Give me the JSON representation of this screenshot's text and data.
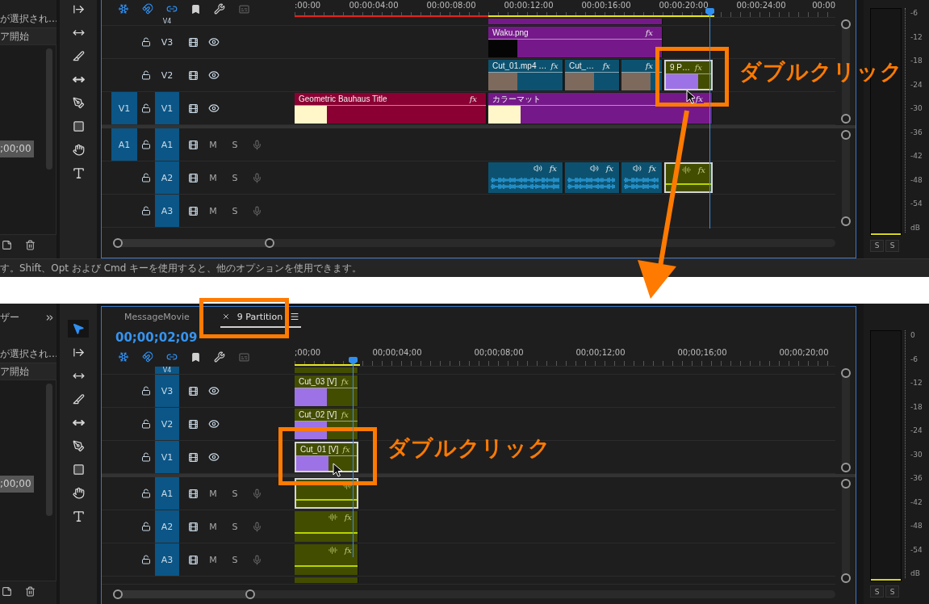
{
  "views": [
    {
      "left_panel": {
        "message": "が選択され…",
        "column": "ア開始",
        "rows": [
          {
            "text": ";00;00",
            "selected": true
          }
        ]
      },
      "tools": [
        {
          "kind": "track_select",
          "selected": false
        },
        {
          "kind": "ripple",
          "selected": false
        },
        {
          "kind": "razor",
          "selected": false
        },
        {
          "kind": "slip",
          "selected": false
        },
        {
          "kind": "pen",
          "selected": false
        },
        {
          "kind": "rectangle",
          "selected": false
        },
        {
          "kind": "hand",
          "selected": false
        },
        {
          "kind": "type",
          "selected": false
        }
      ],
      "toolbar": [
        {
          "kind": "nest",
          "on": true
        },
        {
          "kind": "snap",
          "on": true
        },
        {
          "kind": "linked",
          "on": true
        },
        {
          "kind": "marker",
          "on": false
        },
        {
          "kind": "settings",
          "on": false
        },
        {
          "kind": "captions",
          "on": false
        }
      ],
      "ruler": [
        ":00:00",
        "00:00:04:00",
        "00:00:08:00",
        "00:00:12:00",
        "00:00:16:00",
        "00:00:20:00",
        "00:00:24:00",
        "00:00"
      ],
      "tracks": [
        {
          "kind": "video",
          "label": "V4",
          "targeted": false,
          "clips": [
            {
              "kind": "strip",
              "color": "#75198a",
              "selected": false
            }
          ]
        },
        {
          "kind": "video",
          "label": "V3",
          "targeted": false,
          "clips": [
            {
              "kind": "image",
              "title": "Waku.png",
              "fx": "fx",
              "color": "#75198a",
              "selected": false
            }
          ]
        },
        {
          "kind": "video",
          "label": "V2",
          "targeted": false,
          "clips": [
            {
              "kind": "video",
              "title": "Cut_01.mp4 …",
              "fx": "fx",
              "color": "#0c5270",
              "selected": false
            },
            {
              "kind": "video",
              "title": "Cut_…",
              "fx": "fx",
              "color": "#0c5270",
              "selected": false
            },
            {
              "kind": "video",
              "fx": "fx",
              "color": "#0c5270",
              "selected": false
            },
            {
              "kind": "nest",
              "title": "9 P…",
              "fx": "fx",
              "color": "#434d00",
              "selected": true
            }
          ]
        },
        {
          "kind": "video",
          "label": "V1",
          "source": "V1",
          "targeted": true,
          "clips": [
            {
              "kind": "graphic",
              "title": "Geometric Bauhaus Title",
              "fx": "fx",
              "color": "#8a0032",
              "selected": false
            },
            {
              "kind": "graphic",
              "title": "カラーマット",
              "fx": "fx",
              "color": "#75198a",
              "selected": false
            }
          ]
        },
        {
          "kind": "audio",
          "label": "A1",
          "source": "A1",
          "targeted": true,
          "mute": "M",
          "solo": "S"
        },
        {
          "kind": "audio",
          "label": "A2",
          "targeted": true,
          "mute": "M",
          "solo": "S",
          "clips": [
            {
              "kind": "audio",
              "fx": "fx",
              "color": "#0c5270",
              "selected": false
            },
            {
              "kind": "audio",
              "fx": "fx",
              "color": "#0c5270",
              "selected": false
            },
            {
              "kind": "audio",
              "fx": "fx",
              "color": "#0c5270",
              "selected": false
            },
            {
              "kind": "nest_audio",
              "fx": "fx",
              "color": "#434d00",
              "selected": true
            }
          ]
        },
        {
          "kind": "audio",
          "label": "A3",
          "targeted": true,
          "mute": "M",
          "solo": "S"
        }
      ],
      "meter": {
        "scale": [
          "-6",
          "-12",
          "-18",
          "-24",
          "-30",
          "-36",
          "-42",
          "-48",
          "-54",
          "dB"
        ],
        "solo": [
          "S",
          "S"
        ]
      }
    },
    {
      "left_panel": {
        "tab": "ザー",
        "message": "が選択され…",
        "column": "ア開始",
        "rows": [
          {
            "text": ";00;00",
            "selected": true
          }
        ]
      },
      "tabs": [
        {
          "label": "MessageMovie",
          "selected": false
        },
        {
          "label": "9 Partition",
          "selected": true
        }
      ],
      "timecode": "00;00;02;09",
      "tools": [
        {
          "kind": "selection",
          "selected": true
        },
        {
          "kind": "track_select",
          "selected": false
        },
        {
          "kind": "ripple",
          "selected": false
        },
        {
          "kind": "razor",
          "selected": false
        },
        {
          "kind": "slip",
          "selected": false
        },
        {
          "kind": "pen",
          "selected": false
        },
        {
          "kind": "rectangle",
          "selected": false
        },
        {
          "kind": "hand",
          "selected": false
        },
        {
          "kind": "type",
          "selected": false
        }
      ],
      "toolbar": [
        {
          "kind": "nest",
          "on": true
        },
        {
          "kind": "snap",
          "on": true
        },
        {
          "kind": "linked",
          "on": true
        },
        {
          "kind": "marker",
          "on": false
        },
        {
          "kind": "settings",
          "on": false
        },
        {
          "kind": "captions",
          "on": false
        }
      ],
      "ruler": [
        ";00;00",
        "00;00;04;00",
        "00;00;08;00",
        "00;00;12;00",
        "00;00;16;00",
        "00;00;20;00"
      ],
      "tracks": [
        {
          "kind": "video",
          "label": "V4",
          "targeted": true,
          "clips": [
            {
              "kind": "strip",
              "color": "#434d00",
              "selected": false
            }
          ]
        },
        {
          "kind": "video",
          "label": "V3",
          "targeted": true,
          "clips": [
            {
              "kind": "nest",
              "title": "Cut_03 [V]",
              "fx": "fx",
              "color": "#434d00",
              "selected": false
            }
          ]
        },
        {
          "kind": "video",
          "label": "V2",
          "targeted": true,
          "clips": [
            {
              "kind": "nest",
              "title": "Cut_02 [V]",
              "fx": "fx",
              "color": "#434d00",
              "selected": false
            }
          ]
        },
        {
          "kind": "video",
          "label": "V1",
          "targeted": true,
          "clips": [
            {
              "kind": "nest",
              "title": "Cut_01 [V]",
              "fx": "fx",
              "color": "#434d00",
              "selected": true
            }
          ]
        },
        {
          "kind": "audio",
          "label": "A1",
          "targeted": true,
          "mute": "M",
          "solo": "S",
          "clips": [
            {
              "kind": "nest_audio",
              "color": "#434d00",
              "selected": true
            }
          ]
        },
        {
          "kind": "audio",
          "label": "A2",
          "targeted": true,
          "mute": "M",
          "solo": "S",
          "clips": [
            {
              "kind": "nest_audio",
              "fx": "fx",
              "color": "#434d00",
              "selected": false
            }
          ]
        },
        {
          "kind": "audio",
          "label": "A3",
          "targeted": true,
          "mute": "M",
          "solo": "S",
          "clips": [
            {
              "kind": "nest_audio",
              "fx": "fx",
              "color": "#434d00",
              "selected": false
            }
          ]
        },
        {
          "kind": "audio",
          "clips": [
            {
              "kind": "strip",
              "color": "#434d00",
              "selected": false
            }
          ]
        }
      ],
      "meter": {
        "scale": [
          "0",
          "-6",
          "-12",
          "-18",
          "-24",
          "-30",
          "-36",
          "-42",
          "-48",
          "-54",
          "dB"
        ],
        "solo": [
          "S",
          "S"
        ]
      }
    }
  ],
  "status_bar": "す。Shift、Opt および Cmd キーを使用すると、他のオプションを使用できます。",
  "callouts": [
    {
      "text": "ダブルクリック"
    },
    {
      "text": "ダブルクリック"
    }
  ]
}
